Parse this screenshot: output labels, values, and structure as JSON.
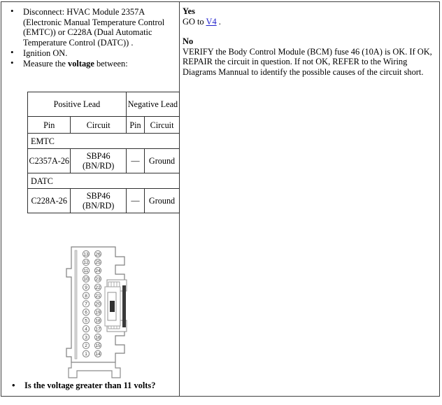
{
  "document": {
    "type": "diagnostic-pinpoint-test-step",
    "left_panel": {
      "steps": [
        {
          "id": "step-disconnect",
          "segments": [
            {
              "text": "Disconnect: HVAC Module 2357A (Electronic Manual Temperature Control (EMTC)) or C228A (Dual Automatic Temperature Control (DATC)) .",
              "bold": false
            }
          ]
        },
        {
          "id": "step-ignition",
          "segments": [
            {
              "text": "Ignition ON.",
              "bold": false
            }
          ]
        },
        {
          "id": "step-measure",
          "segments": [
            {
              "text": "Measure the ",
              "bold": false
            },
            {
              "text": "voltage",
              "bold": true
            },
            {
              "text": " between:",
              "bold": false
            }
          ]
        }
      ],
      "table": {
        "name": "lead-table",
        "group_headers": [
          {
            "label": "Positive Lead",
            "colspan": 2
          },
          {
            "label": "Negative Lead",
            "colspan": 2
          }
        ],
        "column_headers": [
          "Pin",
          "Circuit",
          "Pin",
          "Circuit"
        ],
        "groups": [
          {
            "label": "EMTC",
            "rows": [
              {
                "pos_pin": "C2357A-26",
                "pos_circuit": "SBP46 (BN/RD)",
                "neg_pin": "—",
                "neg_circuit": "Ground"
              }
            ]
          },
          {
            "label": "DATC",
            "rows": [
              {
                "pos_pin": "C228A-26",
                "pos_circuit": "SBP46 (BN/RD)",
                "neg_pin": "—",
                "neg_circuit": "Ground"
              }
            ]
          }
        ]
      },
      "connector_diagram": {
        "name": "connector-pinout-diagram",
        "description": "26-pin rectangular connector face view",
        "left_column_pins": [
          "13",
          "12",
          "11",
          "10",
          "9",
          "8",
          "7",
          "6",
          "5",
          "4",
          "3",
          "2",
          "1"
        ],
        "right_column_pins": [
          "26",
          "25",
          "24",
          "23",
          "22",
          "21",
          "20",
          "19",
          "18",
          "17",
          "16",
          "15",
          "14"
        ]
      },
      "question": "Is the voltage greater than 11 volts?"
    },
    "right_panel": {
      "yes_label": "Yes",
      "yes_prefix": "GO to ",
      "yes_link": "V4",
      "yes_suffix": " .",
      "no_label": "No",
      "no_text": "VERIFY the Body Control Module (BCM) fuse 46 (10A) is OK. If OK, REPAIR the circuit in question. If not OK, REFER to the Wiring Diagrams Mannual to identify the possible causes of the circuit short."
    }
  },
  "colors": {
    "link": "#2222cc",
    "border": "#404040",
    "table_border": "#303030",
    "text": "#000000"
  }
}
